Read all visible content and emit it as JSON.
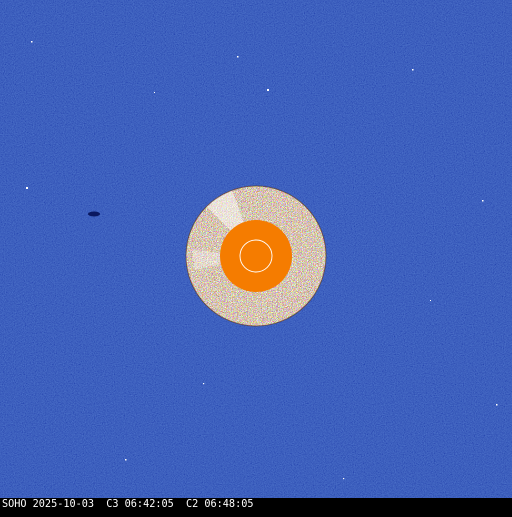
{
  "caption": {
    "text": "SOHO 2025-10-03  C3 06:42:05  C2 06:48:05"
  },
  "image": {
    "subject": "LASCO coronagraph composite (C3 field with C2 inset)",
    "colors": {
      "background_blue": "#1f3fae",
      "c2_light": "#f4ece0",
      "c2_dark": "#4a2410",
      "occulter_orange": "#f57c00",
      "sun_outline": "#ffffff",
      "caption_bg": "#000000",
      "caption_text": "#ffffff"
    }
  }
}
